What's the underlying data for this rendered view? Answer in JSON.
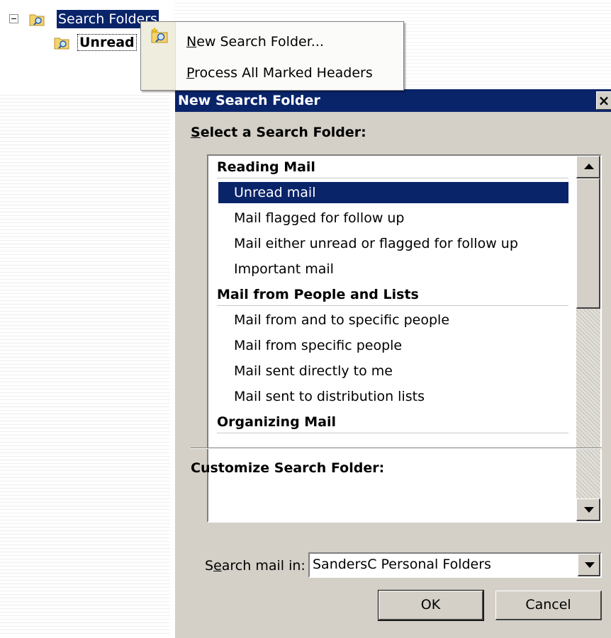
{
  "tree": {
    "root_label": "Search Folders",
    "child_label": "Unread"
  },
  "context_menu": {
    "items": [
      {
        "label_before": "",
        "accel": "N",
        "label_after": "ew Search Folder..."
      },
      {
        "label_before": "",
        "accel": "P",
        "label_after": "rocess All Marked Headers"
      }
    ]
  },
  "dialog": {
    "title": "New Search Folder",
    "close_glyph": "×",
    "select_label_accel": "S",
    "select_label_rest": "elect a Search Folder:",
    "list": [
      {
        "type": "group",
        "label": "Reading Mail"
      },
      {
        "type": "item",
        "label": "Unread mail",
        "selected": true
      },
      {
        "type": "item",
        "label": "Mail flagged for follow up"
      },
      {
        "type": "item",
        "label": "Mail either unread or flagged for follow up"
      },
      {
        "type": "item",
        "label": "Important mail"
      },
      {
        "type": "group",
        "label": "Mail from People and Lists"
      },
      {
        "type": "item",
        "label": "Mail from and to specific people"
      },
      {
        "type": "item",
        "label": "Mail from specific people"
      },
      {
        "type": "item",
        "label": "Mail sent directly to me"
      },
      {
        "type": "item",
        "label": "Mail sent to distribution lists"
      },
      {
        "type": "group",
        "label": "Organizing Mail"
      }
    ],
    "customize_label": "Customize Search Folder:",
    "search_in_before": "S",
    "search_in_accel": "e",
    "search_in_after": "arch mail in:",
    "search_in_value": "SandersC Personal Folders",
    "ok_label": "OK",
    "cancel_label": "Cancel"
  },
  "colors": {
    "selection": "#0a246a",
    "dialog_face": "#d4d0c8",
    "menu_gutter": "#efedde"
  },
  "icons": [
    "search-folder-icon",
    "new-search-folder-icon",
    "collapse-icon",
    "scroll-up-icon",
    "scroll-down-icon",
    "dropdown-arrow-icon"
  ]
}
